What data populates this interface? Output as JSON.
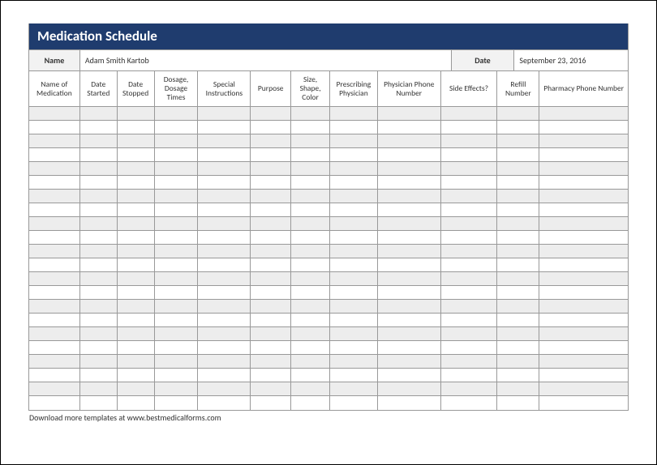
{
  "form": {
    "title": "Medication Schedule",
    "name_label": "Name",
    "name_value": "Adam Smith Kartob",
    "date_label": "Date",
    "date_value": "September 23, 2016"
  },
  "columns": [
    "Name of Medication",
    "Date Started",
    "Date Stopped",
    "Dosage, Dosage Times",
    "Special Instructions",
    "Purpose",
    "Size, Shape, Color",
    "Prescribing Physician",
    "Physician Phone Number",
    "Side Effects?",
    "Refill Number",
    "Pharmacy Phone Number"
  ],
  "rows": [
    [
      "",
      "",
      "",
      "",
      "",
      "",
      "",
      "",
      "",
      "",
      "",
      ""
    ],
    [
      "",
      "",
      "",
      "",
      "",
      "",
      "",
      "",
      "",
      "",
      "",
      ""
    ],
    [
      "",
      "",
      "",
      "",
      "",
      "",
      "",
      "",
      "",
      "",
      "",
      ""
    ],
    [
      "",
      "",
      "",
      "",
      "",
      "",
      "",
      "",
      "",
      "",
      "",
      ""
    ],
    [
      "",
      "",
      "",
      "",
      "",
      "",
      "",
      "",
      "",
      "",
      "",
      ""
    ],
    [
      "",
      "",
      "",
      "",
      "",
      "",
      "",
      "",
      "",
      "",
      "",
      ""
    ],
    [
      "",
      "",
      "",
      "",
      "",
      "",
      "",
      "",
      "",
      "",
      "",
      ""
    ],
    [
      "",
      "",
      "",
      "",
      "",
      "",
      "",
      "",
      "",
      "",
      "",
      ""
    ],
    [
      "",
      "",
      "",
      "",
      "",
      "",
      "",
      "",
      "",
      "",
      "",
      ""
    ],
    [
      "",
      "",
      "",
      "",
      "",
      "",
      "",
      "",
      "",
      "",
      "",
      ""
    ],
    [
      "",
      "",
      "",
      "",
      "",
      "",
      "",
      "",
      "",
      "",
      "",
      ""
    ],
    [
      "",
      "",
      "",
      "",
      "",
      "",
      "",
      "",
      "",
      "",
      "",
      ""
    ],
    [
      "",
      "",
      "",
      "",
      "",
      "",
      "",
      "",
      "",
      "",
      "",
      ""
    ],
    [
      "",
      "",
      "",
      "",
      "",
      "",
      "",
      "",
      "",
      "",
      "",
      ""
    ],
    [
      "",
      "",
      "",
      "",
      "",
      "",
      "",
      "",
      "",
      "",
      "",
      ""
    ],
    [
      "",
      "",
      "",
      "",
      "",
      "",
      "",
      "",
      "",
      "",
      "",
      ""
    ],
    [
      "",
      "",
      "",
      "",
      "",
      "",
      "",
      "",
      "",
      "",
      "",
      ""
    ],
    [
      "",
      "",
      "",
      "",
      "",
      "",
      "",
      "",
      "",
      "",
      "",
      ""
    ],
    [
      "",
      "",
      "",
      "",
      "",
      "",
      "",
      "",
      "",
      "",
      "",
      ""
    ],
    [
      "",
      "",
      "",
      "",
      "",
      "",
      "",
      "",
      "",
      "",
      "",
      ""
    ],
    [
      "",
      "",
      "",
      "",
      "",
      "",
      "",
      "",
      "",
      "",
      "",
      ""
    ],
    [
      "",
      "",
      "",
      "",
      "",
      "",
      "",
      "",
      "",
      "",
      "",
      ""
    ]
  ],
  "footer": "Download more templates at www.bestmedicalforms.com"
}
